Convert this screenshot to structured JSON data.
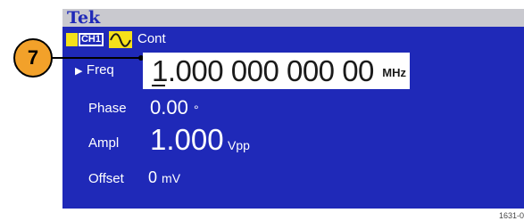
{
  "brand": "Tek",
  "status": {
    "channel": "CH1",
    "waveform_icon": "sine-wave-icon",
    "run_mode": "Cont"
  },
  "callout": {
    "number": "7"
  },
  "params": {
    "freq_arrow": "▶",
    "freq_label": "Freq",
    "freq_value": "1.000 000 000 00",
    "freq_unit": "MHz",
    "phase_label": "Phase",
    "phase_value": "0.00",
    "phase_unit": "°",
    "ampl_label": "Ampl",
    "ampl_value": "1.000",
    "ampl_unit": "Vpp",
    "offset_label": "Offset",
    "offset_value": "0",
    "offset_unit": "mV"
  },
  "footer_code": "1631-0",
  "colors": {
    "screen_bg": "#1f29b8",
    "title_bg": "#c9c9cf",
    "channel_yellow": "#f5e11a",
    "callout_orange": "#f2a12a"
  }
}
